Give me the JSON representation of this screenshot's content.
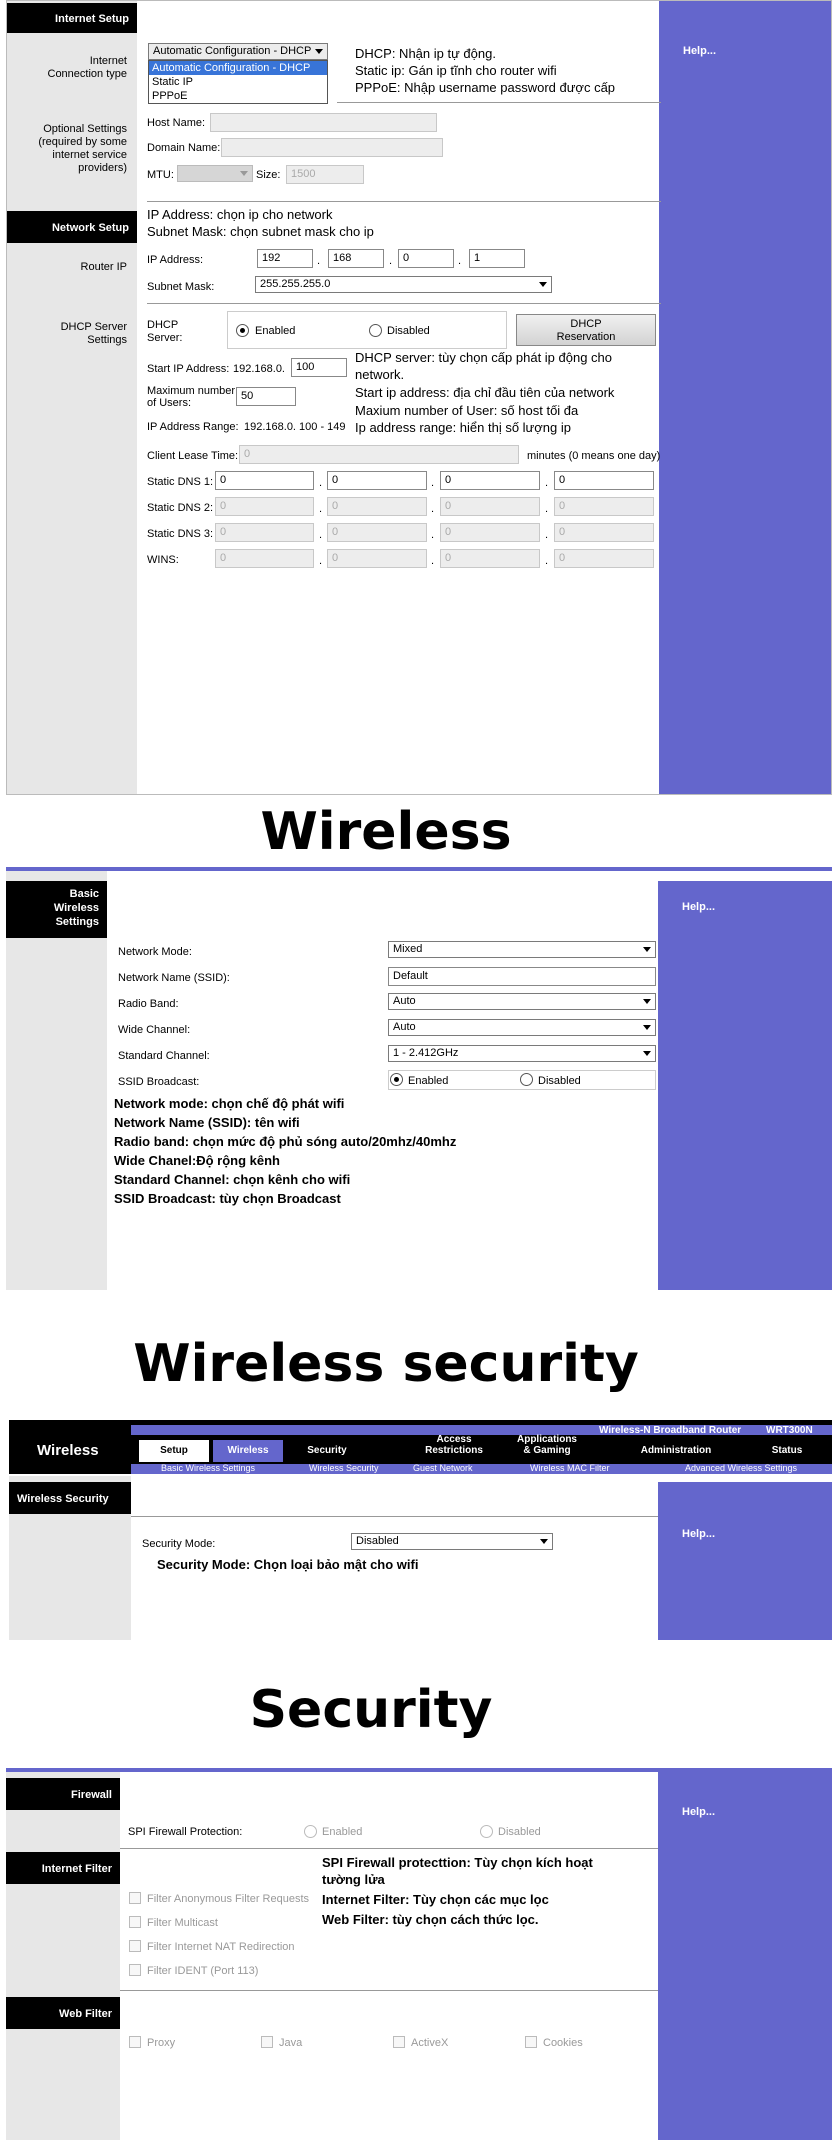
{
  "colors": {
    "help_bg": "#6466cc",
    "left_col": "#e7e7e7",
    "header_black": "#000000",
    "nav_purple": "#6466cc"
  },
  "setup": {
    "headers": {
      "internet": "Internet Setup",
      "network": "Network Setup"
    },
    "labels": {
      "conn_type": "Internet\nConnection type",
      "optional": "Optional Settings\n(required by some\ninternet service\nproviders)",
      "router_ip": "Router IP",
      "dhcp": "DHCP Server\nSettings"
    },
    "conn_select": "Automatic Configuration - DHCP",
    "conn_options": [
      "Automatic Configuration - DHCP",
      "Static IP",
      "PPPoE"
    ],
    "notes_conn": [
      "DHCP: Nhận ip tự động.",
      "Static ip: Gán ip tĩnh cho router wifi",
      "PPPoE: Nhập username password được cấp"
    ],
    "host_name": "Host Name:",
    "domain_name": "Domain Name:",
    "mtu": "MTU:",
    "size": "Size:",
    "size_value": "1500",
    "notes_ip": [
      "IP Address: chọn ip cho network",
      "Subnet Mask: chọn subnet mask cho ip"
    ],
    "ip_label": "IP Address:",
    "ip": [
      "192",
      "168",
      "0",
      "1"
    ],
    "subnet_label": "Subnet Mask:",
    "subnet": "255.255.255.0",
    "dhcp_server_label": "DHCP\nServer:",
    "enabled": "Enabled",
    "disabled": "Disabled",
    "dhcp_reservation": "DHCP\nReservation",
    "start_ip_label": "Start IP Address:",
    "start_ip_prefix": "192.168.0.",
    "start_ip": "100",
    "max_users_label": "Maximum number\nof Users:",
    "max_users": "50",
    "ip_range_label": "IP Address Range:",
    "ip_range": "192.168.0.  100  -  149",
    "notes_dhcp": [
      "DHCP server: tùy chọn cấp phát ip động cho",
      "network.",
      "Start ip address: địa chỉ đầu tiên của network",
      "Maxium number of User: số host tối đa",
      "Ip address range: hiển thị số lượng ip"
    ],
    "lease_label": "Client Lease Time:",
    "lease_value": "0",
    "lease_unit": "minutes (0 means one day)",
    "dns1_label": "Static DNS 1:",
    "dns2_label": "Static DNS 2:",
    "dns3_label": "Static DNS 3:",
    "wins_label": "WINS:",
    "zero": "0",
    "help": "Help..."
  },
  "titles": {
    "wireless": "Wireless",
    "wireless_security": "Wireless security",
    "security": "Security"
  },
  "wireless": {
    "header": "Basic\nWireless\nSettings",
    "rows": [
      {
        "label": "Network Mode:",
        "value": "Mixed"
      },
      {
        "label": "Network Name (SSID):",
        "value": "Default"
      },
      {
        "label": "Radio Band:",
        "value": "Auto"
      },
      {
        "label": "Wide Channel:",
        "value": "Auto"
      },
      {
        "label": "Standard Channel:",
        "value": "1 - 2.412GHz"
      }
    ],
    "ssid_label": "SSID Broadcast:",
    "enabled": "Enabled",
    "disabled": "Disabled",
    "notes": [
      "Network mode: chọn chế độ phát wifi",
      "Network Name (SSID): tên wifi",
      "Radio band: chọn mức độ phủ sóng auto/20mhz/40mhz",
      "Wide Chanel:Độ rộng kênh",
      "Standard Channel: chọn kênh cho wifi",
      "SSID Broadcast: tùy chọn Broadcast"
    ],
    "help": "Help..."
  },
  "wsec": {
    "product": "Wireless-N Broadband Router",
    "model": "WRT300N",
    "section": "Wireless",
    "tabs": [
      "Setup",
      "Wireless",
      "Security",
      "Access\nRestrictions",
      "Applications\n& Gaming",
      "Administration",
      "Status"
    ],
    "subtabs": [
      "Basic Wireless Settings",
      "Wireless Security",
      "Guest Network",
      "Wireless MAC Filter",
      "Advanced Wireless Settings"
    ],
    "header": "Wireless Security",
    "mode_label": "Security Mode:",
    "mode_value": "Disabled",
    "note": "Security Mode: Chọn loại bảo mật cho wifi",
    "help": "Help..."
  },
  "security": {
    "headers": {
      "firewall": "Firewall",
      "internet_filter": "Internet Filter",
      "web_filter": "Web Filter"
    },
    "spi_label": "SPI Firewall Protection:",
    "enabled": "Enabled",
    "disabled": "Disabled",
    "filters": [
      "Filter Anonymous Filter Requests",
      "Filter Multicast",
      "Filter Internet NAT Redirection",
      "Filter IDENT (Port 113)"
    ],
    "web": [
      "Proxy",
      "Java",
      "ActiveX",
      "Cookies"
    ],
    "notes": [
      "SPI Firewall protecttion: Tùy chọn kích hoạt",
      "tường lửa",
      "Internet Filter: Tùy chọn các mục lọc",
      "Web Filter: tùy chọn cách thức lọc."
    ],
    "help": "Help..."
  }
}
